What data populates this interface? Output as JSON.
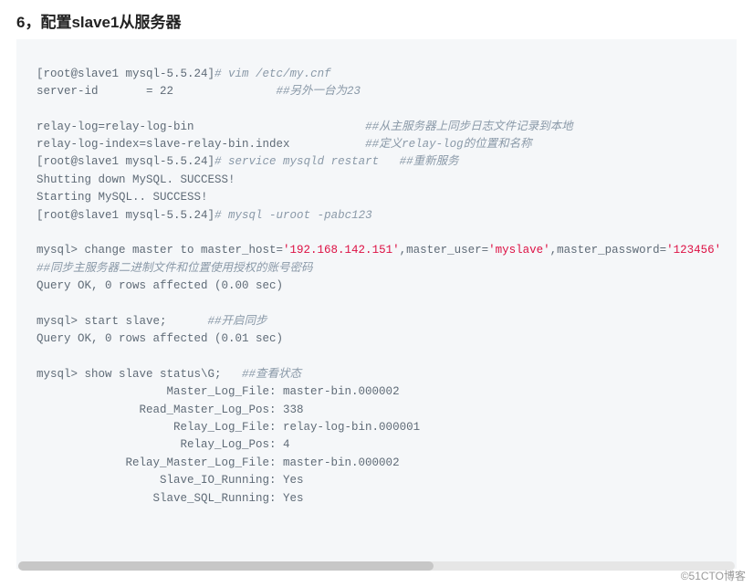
{
  "heading": "6，配置slave1从服务器",
  "code": {
    "l1_a": "[root@slave1 mysql-5.5.24]",
    "l1_b": "# vim /etc/my.cnf",
    "l2_a": "server-id       = 22               ",
    "l2_b": "##另外一台为23",
    "blank1": "",
    "l3_a": "relay-log=relay-log-bin                         ",
    "l3_b": "##从主服务器上同步日志文件记录到本地",
    "l4_a": "relay-log-index=slave-relay-bin.index           ",
    "l4_b": "##定义relay-log的位置和名称",
    "l5_a": "[root@slave1 mysql-5.5.24]",
    "l5_b": "# service mysqld restart   ",
    "l5_c": "##重新服务",
    "l6": "Shutting down MySQL. SUCCESS!",
    "l7": "Starting MySQL.. SUCCESS!",
    "l8_a": "[root@slave1 mysql-5.5.24]",
    "l8_b": "# mysql -uroot -pabc123",
    "blank2": "",
    "l9_a": "mysql> change master to master_host=",
    "l9_b": "'192.168.142.151'",
    "l9_c": ",master_user=",
    "l9_d": "'myslave'",
    "l9_e": ",master_password=",
    "l9_f": "'123456'",
    "l10": "##同步主服务器二进制文件和位置使用授权的账号密码",
    "l11": "Query OK, 0 rows affected (0.00 sec)",
    "blank3": "",
    "l12_a": "mysql> start slave;      ",
    "l12_b": "##开启同步",
    "l13": "Query OK, 0 rows affected (0.01 sec)",
    "blank4": "",
    "l14_a": "mysql> show slave status\\G;   ",
    "l14_b": "##查看状态",
    "l15": "                   Master_Log_File: master-bin.000002",
    "l16": "               Read_Master_Log_Pos: 338",
    "l17": "                    Relay_Log_File: relay-log-bin.000001",
    "l18": "                     Relay_Log_Pos: 4",
    "l19": "             Relay_Master_Log_File: master-bin.000002",
    "l20": "                  Slave_IO_Running: Yes",
    "l21": "                 Slave_SQL_Running: Yes"
  },
  "watermark": "©51CTO博客"
}
